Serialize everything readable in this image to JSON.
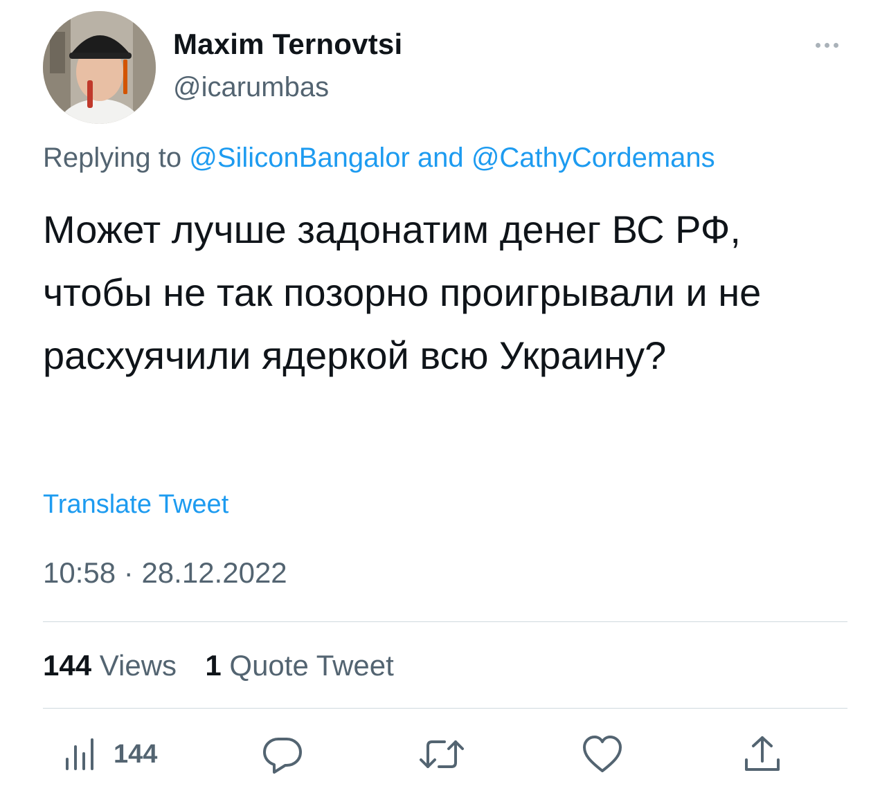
{
  "author": {
    "name": "Maxim Ternovtsi",
    "handle": "@icarumbas"
  },
  "reply": {
    "prefix": "Replying to",
    "user1": "@SiliconBangalor",
    "joiner": "and",
    "user2": "@CathyCordemans"
  },
  "tweet": {
    "text": "Может лучше задонатим денег ВС РФ, чтобы не так позорно проигрывали и не расхуячили ядеркой всю Украину?",
    "translate_label": "Translate Tweet",
    "time": "10:58",
    "date": "28.12.2022"
  },
  "stats": {
    "views_count": "144",
    "views_label": "Views",
    "quotes_count": "1",
    "quotes_label": "Quote Tweet"
  },
  "actions": {
    "views_count": "144",
    "icons": [
      "analytics-icon",
      "reply-icon",
      "retweet-icon",
      "like-icon",
      "share-icon"
    ]
  },
  "colors": {
    "accent": "#1d9bf0",
    "secondary_text": "#536471",
    "primary_text": "#0f1419",
    "divider": "#cfd9de",
    "icon": "#536471"
  }
}
